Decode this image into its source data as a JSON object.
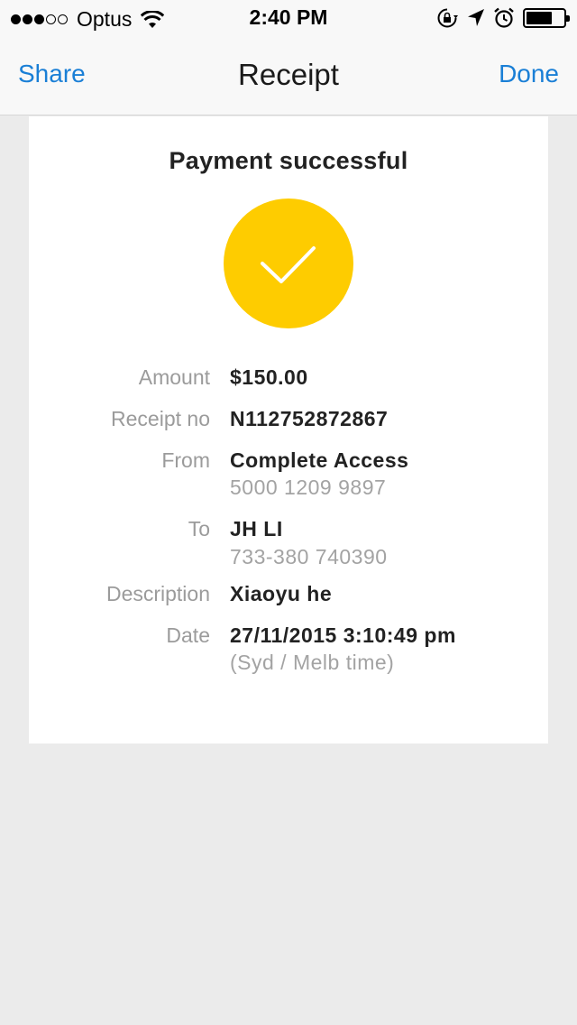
{
  "status_bar": {
    "carrier": "Optus",
    "time": "2:40 PM",
    "signal_bars_filled": 3,
    "signal_bars_total": 5,
    "battery_level": 0.7,
    "icons": [
      "signal-dots-icon",
      "wifi-icon",
      "rotation-lock-icon",
      "location-arrow-icon",
      "alarm-icon",
      "battery-icon"
    ]
  },
  "nav": {
    "share_label": "Share",
    "title": "Receipt",
    "done_label": "Done",
    "accent_color": "#1a7fd6"
  },
  "receipt": {
    "title": "Payment successful",
    "status_icon": "checkmark-icon",
    "status_color": "#fecc00",
    "rows": [
      {
        "label": "Amount",
        "value": "$150.00"
      },
      {
        "label": "Receipt no",
        "value": "N112752872867"
      },
      {
        "label": "From",
        "value": "Complete Access",
        "sub": "5000 1209 9897"
      },
      {
        "label": "To",
        "value": "JH LI",
        "sub": "733-380 740390"
      },
      {
        "label": "Description",
        "value": "Xiaoyu he"
      },
      {
        "label": "Date",
        "value": "27/11/2015 3:10:49 pm",
        "sub": "(Syd / Melb time)"
      }
    ]
  }
}
